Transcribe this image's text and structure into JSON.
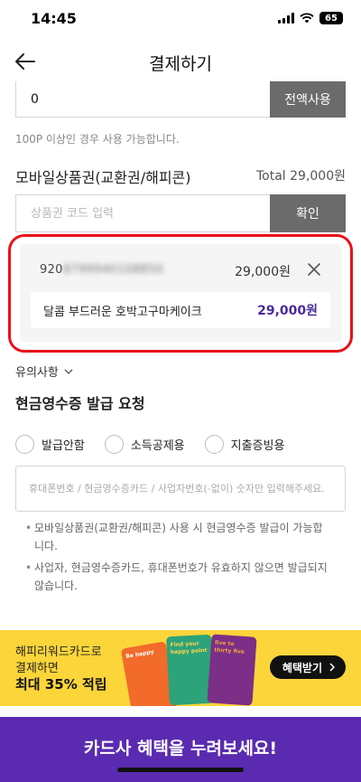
{
  "status_bar": {
    "time": "14:45",
    "battery": "65"
  },
  "header": {
    "title": "결제하기"
  },
  "points": {
    "value": "0",
    "use_all_label": "전액사용",
    "note": "100P 이상인 경우 사용 가능합니다."
  },
  "gift_card": {
    "title": "모바일상품권(교환권/해피콘)",
    "total": "Total 29,000원",
    "code_placeholder": "상품권 코드 입력",
    "confirm_label": "확인",
    "item": {
      "code_visible": "920",
      "code_hidden": "8799940108850",
      "amount": "29,000원",
      "product_name": "달콤 부드러운 호박고구마케이크",
      "product_price": "29,000원"
    }
  },
  "notice": {
    "label": "유의사항"
  },
  "receipt": {
    "title": "현금영수증 발급 요청",
    "options": [
      "발급안함",
      "소득공제용",
      "지출증빙용"
    ],
    "input_placeholder": "휴대폰번호 / 현금영수증카드 / 사업자번호(-없이) 숫자만 입력해주세요.",
    "notes": [
      "모바일상품권(교환권/해피콘) 사용 시 현금영수증 발급이 가능합니다.",
      "사업자, 현금영수증카드, 휴대폰번호가 유효하지 않으면 발급되지 않습니다."
    ]
  },
  "promo": {
    "line1": "해피리워드카드로",
    "line2": "결제하면",
    "line3": "최대 35% 적립",
    "button_label": "혜택받기",
    "card_texts": [
      "Be happy",
      "Find your happy point",
      "five to thirty five"
    ]
  },
  "card_banner": {
    "text": "카드사 혜택을 누려보세요!"
  },
  "colors": {
    "highlight": "#e8121a",
    "accent": "#4a2b9d",
    "promo_bg": "#fcd53a",
    "banner_bg": "#5a2bb0"
  }
}
